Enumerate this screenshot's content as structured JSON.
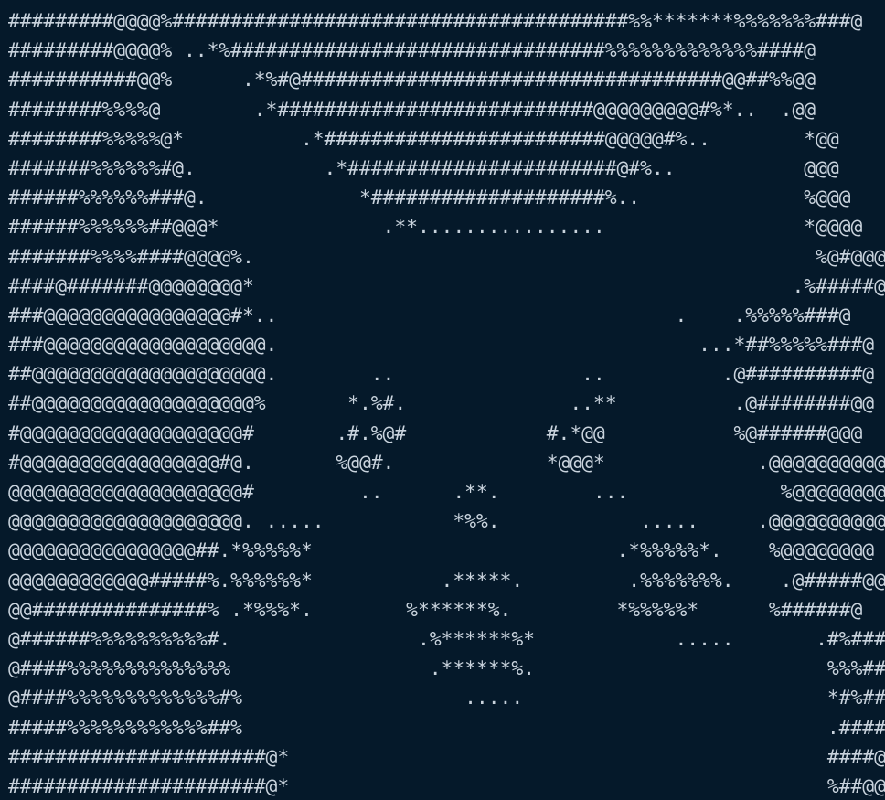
{
  "terminal": {
    "lines": [
      "#########@@@@%#######################################%%*******%%%%%%%###@",
      "#########@@@@% ..*%################################%%%%%%%%%%%%%####@",
      "###########@@%      .*%#@####################################@@##%%@@",
      "########%%%%@        .*###########################@@@@@@@@@#%*..  .@@",
      "########%%%%%@*          .*########################@@@@@#%..        *@@",
      "#######%%%%%%#@.           .*#######################@#%..           @@@",
      "######%%%%%%###@.             *####################%..              %@@@",
      "######%%%%%%##@@@*              .**................                 *@@@@",
      "#######%%%%####@@@@%.                                                %@#@@@",
      "####@#######@@@@@@@@*                                              .%#####@",
      "###@@@@@@@@@@@@@@@@#*..                                  .    .%%%%%###@",
      "###@@@@@@@@@@@@@@@@@@@.                                    ...*##%%%%%###@",
      "##@@@@@@@@@@@@@@@@@@@@.        ..                ..          .@##########@",
      "##@@@@@@@@@@@@@@@@@@@%       *.%#.              ..**          .@########@@",
      "#@@@@@@@@@@@@@@@@@@@#       .#.%@#            #.*@@           %@######@@@",
      "#@@@@@@@@@@@@@@@@@#@.       %@@#.             *@@@*             .@@@@@@@@@@",
      "@@@@@@@@@@@@@@@@@@@@#         ..      .**.        ...             %@@@@@@@@@",
      "@@@@@@@@@@@@@@@@@@@@. .....           *%%.            .....     .@@@@@@@@@@",
      "@@@@@@@@@@@@@@@@##.*%%%%%*                          .*%%%%%*.    %@@@@@@@@",
      "@@@@@@@@@@@@#####%.%%%%%%*           .*****.         .%%%%%%%.    .@#####@@",
      "@@###############% .*%%%*.        %******%.         *%%%%%*      %######@",
      "@######%%%%%%%%%%#.                .%******%*            .....       .#%####@",
      "@####%%%%%%%%%%%%%%                 .******%.                         %%%###@",
      "@####%%%%%%%%%%%%%#%                   .....                          *#%###@",
      "#####%%%%%%%%%%%%##%                                                  .#####@",
      "######################@*                                              ####@@",
      "######################@*                                              %##@@",
      "#########@@@@#.                                              %@@@@@"
    ]
  }
}
